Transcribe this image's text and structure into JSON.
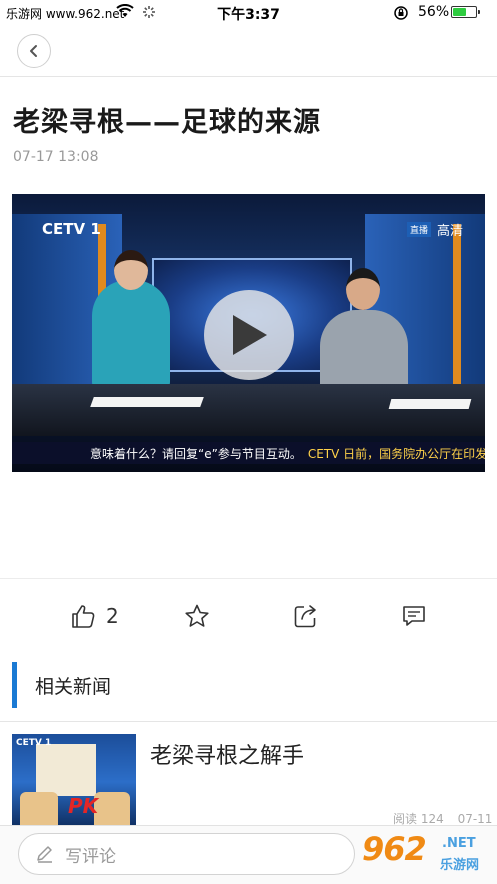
{
  "status_bar": {
    "carrier": "乐游网 www.962.net",
    "time": "下午3:37",
    "battery": "56%",
    "battery_level": 0.56
  },
  "nav": {
    "back_icon": "chevron-left-icon"
  },
  "article": {
    "title": "老梁寻根——足球的来源",
    "datetime": "07-17 13:08"
  },
  "video": {
    "channel_logo": "CETV 1",
    "live_badge": "直播",
    "hd_badge": "高清",
    "ticker_left": "意味着什么？请回复“e”参与节目互动。",
    "ticker_right": "CETV  日前，国务院办公厅在印发",
    "play_icon": "play-icon"
  },
  "actions": {
    "like_count": "2",
    "like_icon": "thumb-up-icon",
    "favorite_icon": "star-icon",
    "share_icon": "share-icon",
    "comment_icon": "comment-icon"
  },
  "related": {
    "section_title": "相关新闻",
    "items": [
      {
        "title": "老梁寻根之解手",
        "reads": "阅读 124",
        "date": "07-11",
        "thumb_logo": "CETV 1",
        "thumb_mark": "PK"
      }
    ]
  },
  "comment": {
    "placeholder": "写评论",
    "pencil_icon": "pencil-icon"
  },
  "watermark": {
    "big": "962",
    "small": ".NET",
    "cn": "乐游网"
  },
  "colors": {
    "accent": "#1a7ad4",
    "battery": "#2ecc40",
    "watermark_orange": "#f08a14"
  }
}
